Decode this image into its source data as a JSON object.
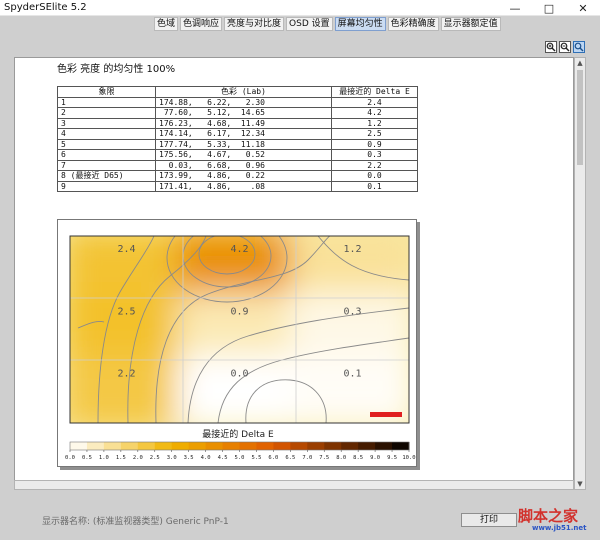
{
  "window": {
    "title": "SpyderSElite 5.2",
    "minimize_glyph": "—",
    "maximize_glyph": "□",
    "close_glyph": "✕"
  },
  "tabs": [
    {
      "label": "色域",
      "active": false
    },
    {
      "label": "色调响应",
      "active": false
    },
    {
      "label": "亮度与对比度",
      "active": false
    },
    {
      "label": "OSD 设置",
      "active": false
    },
    {
      "label": "屏幕均匀性",
      "active": true
    },
    {
      "label": "色彩精确度",
      "active": false
    },
    {
      "label": "显示器额定值",
      "active": false
    }
  ],
  "zoom_icons": [
    "zoom-in-icon",
    "zoom-out-icon",
    "zoom-fit-icon"
  ],
  "report": {
    "title": "色彩 亮度 的均匀性 100%",
    "table": {
      "headers": [
        "象限",
        "色彩 (Lab)",
        "最接近的 Delta E"
      ],
      "rows": [
        {
          "quadrant": "1",
          "lab": "174.88,   6.22,   2.30",
          "delta": "2.4"
        },
        {
          "quadrant": "2",
          "lab": " 77.60,   5.12,  14.65",
          "delta": "4.2"
        },
        {
          "quadrant": "3",
          "lab": "176.23,   4.68,  11.49",
          "delta": "1.2"
        },
        {
          "quadrant": "4",
          "lab": "174.14,   6.17,  12.34",
          "delta": "2.5"
        },
        {
          "quadrant": "5",
          "lab": "177.74,   5.33,  11.18",
          "delta": "0.9"
        },
        {
          "quadrant": "6",
          "lab": "175.56,   4.67,   0.52",
          "delta": "0.3"
        },
        {
          "quadrant": "7",
          "lab": "  0.03,   6.68,   0.96",
          "delta": "2.2"
        },
        {
          "quadrant": "8 (最接近 D65)",
          "lab": "173.99,   4.86,   0.22",
          "delta": "0.0"
        },
        {
          "quadrant": "9",
          "lab": "171.41,   4.86,    .08",
          "delta": "0.1"
        }
      ]
    }
  },
  "chart_data": {
    "type": "heatmap",
    "colorbar_title": "最接近的 Delta E",
    "grid": [
      [
        2.4,
        4.2,
        1.2
      ],
      [
        2.5,
        0.9,
        0.3
      ],
      [
        2.2,
        0.0,
        0.1
      ]
    ],
    "cell_labels": [
      [
        "2.4",
        "4.2",
        "1.2"
      ],
      [
        "2.5",
        "0.9",
        "0.3"
      ],
      [
        "2.2",
        "0.0",
        "0.1"
      ]
    ],
    "colorbar_ticks": [
      "0.0",
      "0.5",
      "1.0",
      "1.5",
      "2.0",
      "2.5",
      "3.0",
      "3.5",
      "4.0",
      "4.5",
      "5.0",
      "5.5",
      "6.0",
      "6.5",
      "7.0",
      "7.5",
      "8.0",
      "8.5",
      "9.0",
      "9.5",
      "10.0"
    ],
    "colorbar_range": [
      0,
      10
    ],
    "colors": {
      "low": "#ffffff",
      "mid": "#f0b400",
      "high": "#e05a00",
      "top": "#000000",
      "marker": "#e02020"
    }
  },
  "footer": {
    "display_label": "显示器名称: (标准监视器类型) Generic PnP-1",
    "print_button": "打印"
  },
  "watermark": {
    "line1": "脚本之家",
    "line2": "www.jb51.net"
  }
}
